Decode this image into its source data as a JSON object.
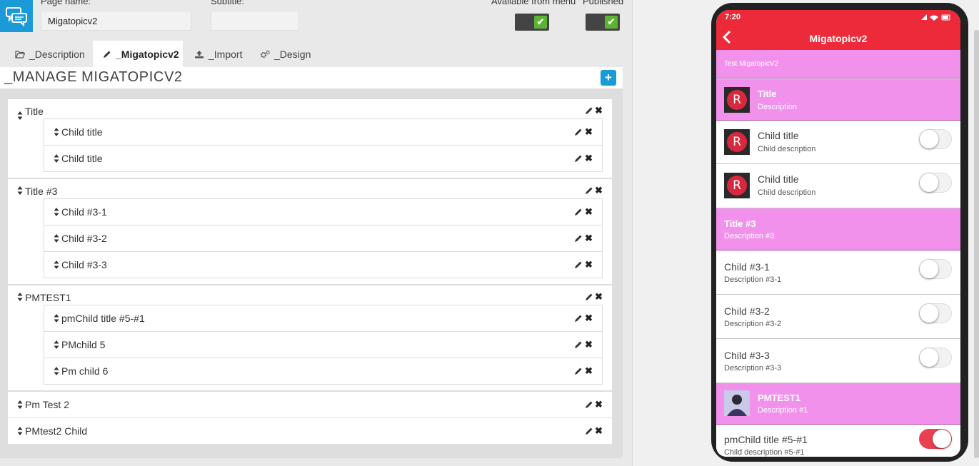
{
  "form": {
    "page_name_label": "Page name:",
    "page_name_value": "Migatopicv2",
    "subtitle_label": "Subtitle:",
    "subtitle_value": "",
    "available_label": "Available from menu",
    "published_label": "Published",
    "available_checked": true,
    "published_checked": true
  },
  "tabs": [
    {
      "label": "_Description",
      "icon": "folder-open-icon"
    },
    {
      "label": "_Migatopicv2",
      "icon": "pencil-icon",
      "active": true
    },
    {
      "label": "_Import",
      "icon": "upload-icon"
    },
    {
      "label": "_Design",
      "icon": "gears-icon"
    }
  ],
  "manage": {
    "title": "_MANAGE MIGATOPICV2",
    "add_label": "+"
  },
  "list": {
    "title": "Title",
    "child_title_1": "Child title",
    "child_title_2": "Child title",
    "title_3": "Title #3",
    "child_3_1": "Child #3-1",
    "child_3_2": "Child #3-2",
    "child_3_3": "Child #3-3",
    "pmtest1": "PMTEST1",
    "pmchild_5_1": "pmChild title #5-#1",
    "pmchild_5": "PMchild 5",
    "pm_child_6": "Pm child 6",
    "pm_test_2": "Pm Test 2",
    "pmtest2_child": "PMtest2 Child"
  },
  "preview": {
    "time": "7:20",
    "header_title": "Migatopicv2",
    "banner": "Test MigatopicV2",
    "items": {
      "title": "Title",
      "title_desc": "Description",
      "child1": "Child title",
      "child1_desc": "Child description",
      "child2": "Child title",
      "child2_desc": "Child description",
      "title3": "Title #3",
      "title3_desc": "Description #3",
      "c31": "Child #3-1",
      "c31_desc": "Description #3-1",
      "c32": "Child #3-2",
      "c32_desc": "Description #3-2",
      "c33": "Child #3-3",
      "c33_desc": "Description #3-3",
      "pmtest1": "PMTEST1",
      "pmtest1_desc": "Description #1",
      "pmc": "pmChild title #5-#1",
      "pmc_desc": "Child description #5-#1"
    },
    "thumb_letter": "R",
    "switch_states": {
      "child1": false,
      "child2": false,
      "c31": false,
      "c32": false,
      "c33": false,
      "pmc": true
    },
    "colors": {
      "header": "#ec2a3a",
      "section": "#f291ec",
      "switch_on": "#e8414f",
      "accent": "#1a9bd7",
      "check": "#5cb531"
    }
  }
}
